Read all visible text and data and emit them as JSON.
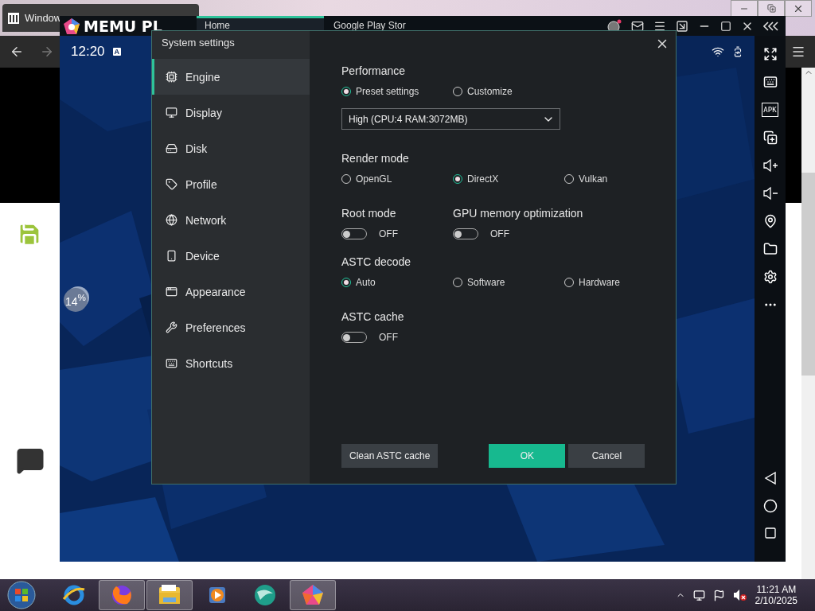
{
  "browser": {
    "tab_title": "Window"
  },
  "emulator": {
    "logo": "MEMU PL",
    "tabs": [
      {
        "label": "Home",
        "selected": true
      },
      {
        "label": "Google Play Stor",
        "selected": false
      }
    ],
    "clock": "12:20",
    "status_badge": "A",
    "apk_label": "APK",
    "progress": "14$^{%}$"
  },
  "settings": {
    "title": "System settings",
    "nav": [
      {
        "label": "Engine",
        "selected": true
      },
      {
        "label": "Display",
        "selected": false
      },
      {
        "label": "Disk",
        "selected": false
      },
      {
        "label": "Profile",
        "selected": false
      },
      {
        "label": "Network",
        "selected": false
      },
      {
        "label": "Device",
        "selected": false
      },
      {
        "label": "Appearance",
        "selected": false
      },
      {
        "label": "Preferences",
        "selected": false
      },
      {
        "label": "Shortcuts",
        "selected": false
      }
    ],
    "performance": {
      "label": "Performance",
      "options": [
        {
          "label": "Preset settings",
          "selected": true
        },
        {
          "label": "Customize",
          "selected": false
        }
      ],
      "preset": "High (CPU:4 RAM:3072MB)"
    },
    "render_mode": {
      "label": "Render mode",
      "options": [
        {
          "label": "OpenGL",
          "selected": false
        },
        {
          "label": "DirectX",
          "selected": true
        },
        {
          "label": "Vulkan",
          "selected": false
        }
      ]
    },
    "toggles": [
      {
        "label": "Root mode",
        "on": false,
        "state": "OFF"
      },
      {
        "label": "GPU memory optimization",
        "on": false,
        "state": "OFF"
      }
    ],
    "astc_decode": {
      "label": "ASTC decode",
      "options": [
        {
          "label": "Auto",
          "selected": true
        },
        {
          "label": "Software",
          "selected": false
        },
        {
          "label": "Hardware",
          "selected": false
        }
      ]
    },
    "astc_cache": {
      "label": "ASTC cache",
      "on": false,
      "state": "OFF"
    },
    "buttons": [
      {
        "label": "Clean ASTC cache",
        "kind": "secondary"
      },
      {
        "label": "OK",
        "kind": "primary"
      },
      {
        "label": "Cancel",
        "kind": "secondary"
      }
    ]
  },
  "taskbar": {
    "apps": [
      {
        "kind": "e-globe",
        "active": false
      },
      {
        "kind": "fox",
        "active": true
      },
      {
        "kind": "folder",
        "active": true
      },
      {
        "kind": "player",
        "active": false
      },
      {
        "kind": "sphere",
        "active": false
      },
      {
        "kind": "pentagon",
        "active": true
      }
    ],
    "time": "11:21 AM",
    "date": "2/10/2025"
  }
}
